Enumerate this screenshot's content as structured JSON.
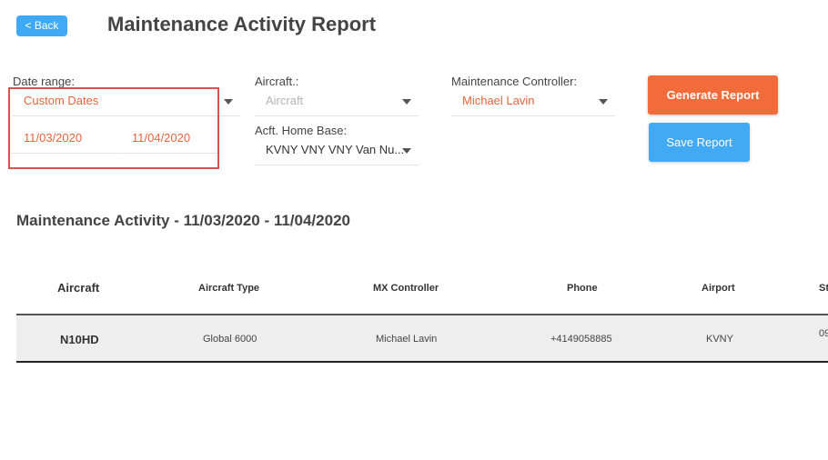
{
  "header": {
    "back_label": "< Back",
    "title": "Maintenance Activity Report"
  },
  "filters": {
    "date_range": {
      "label": "Date range:",
      "value": "Custom Dates",
      "start": "11/03/2020",
      "end": "11/04/2020"
    },
    "aircraft": {
      "label": "Aircraft.:",
      "placeholder": "Aircraft"
    },
    "home_base": {
      "label": "Acft. Home Base:",
      "value": "KVNY VNY VNY Van Nu..."
    },
    "controller": {
      "label": "Maintenance Controller:",
      "value": "Michael Lavin"
    }
  },
  "actions": {
    "generate_label": "Generate Report",
    "save_label": "Save Report"
  },
  "report": {
    "title": "Maintenance Activity - 11/03/2020 - 11/04/2020",
    "columns": [
      "Aircraft",
      "Aircraft Type",
      "MX Controller",
      "Phone",
      "Airport",
      "St"
    ],
    "rows": [
      {
        "aircraft": "N10HD",
        "type": "Global 6000",
        "controller": "Michael Lavin",
        "phone": "+4149058885",
        "airport": "KVNY",
        "partial": "09"
      }
    ]
  },
  "colors": {
    "accent_orange": "#f26b3a",
    "accent_blue": "#42a9f5",
    "highlight_red": "#d9534f"
  }
}
